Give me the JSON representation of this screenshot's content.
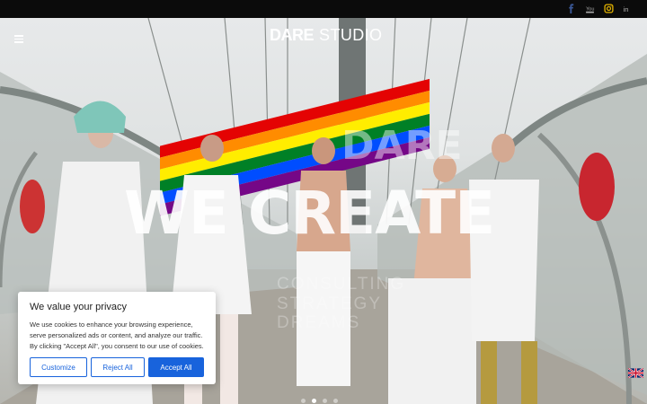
{
  "social": {
    "items": [
      {
        "name": "facebook-icon",
        "color": "#3b5998"
      },
      {
        "name": "youtube-icon",
        "color": "#aaaaaa"
      },
      {
        "name": "instagram-icon",
        "color": "#e1b100"
      },
      {
        "name": "linkedin-icon",
        "color": "#aaaaaa"
      }
    ]
  },
  "logo": {
    "part1": "DARE",
    "part2": "STUDIO"
  },
  "hero": {
    "line1": "DARE",
    "line2": "WE CREATE",
    "sub1": "CONSULTING",
    "sub2": "STRATEGY",
    "sub3": "DREAMS",
    "slides": 4,
    "active_slide": 2
  },
  "cookie": {
    "title": "We value your privacy",
    "body": "We use cookies to enhance your browsing experience, serve personalized ads or content, and analyze our traffic. By clicking \"Accept All\", you consent to our use of cookies.",
    "customize_label": "Customize",
    "reject_label": "Reject All",
    "accept_label": "Accept All",
    "accent": "#1863dc"
  },
  "language": {
    "current": "en",
    "icon": "uk-flag-icon"
  }
}
